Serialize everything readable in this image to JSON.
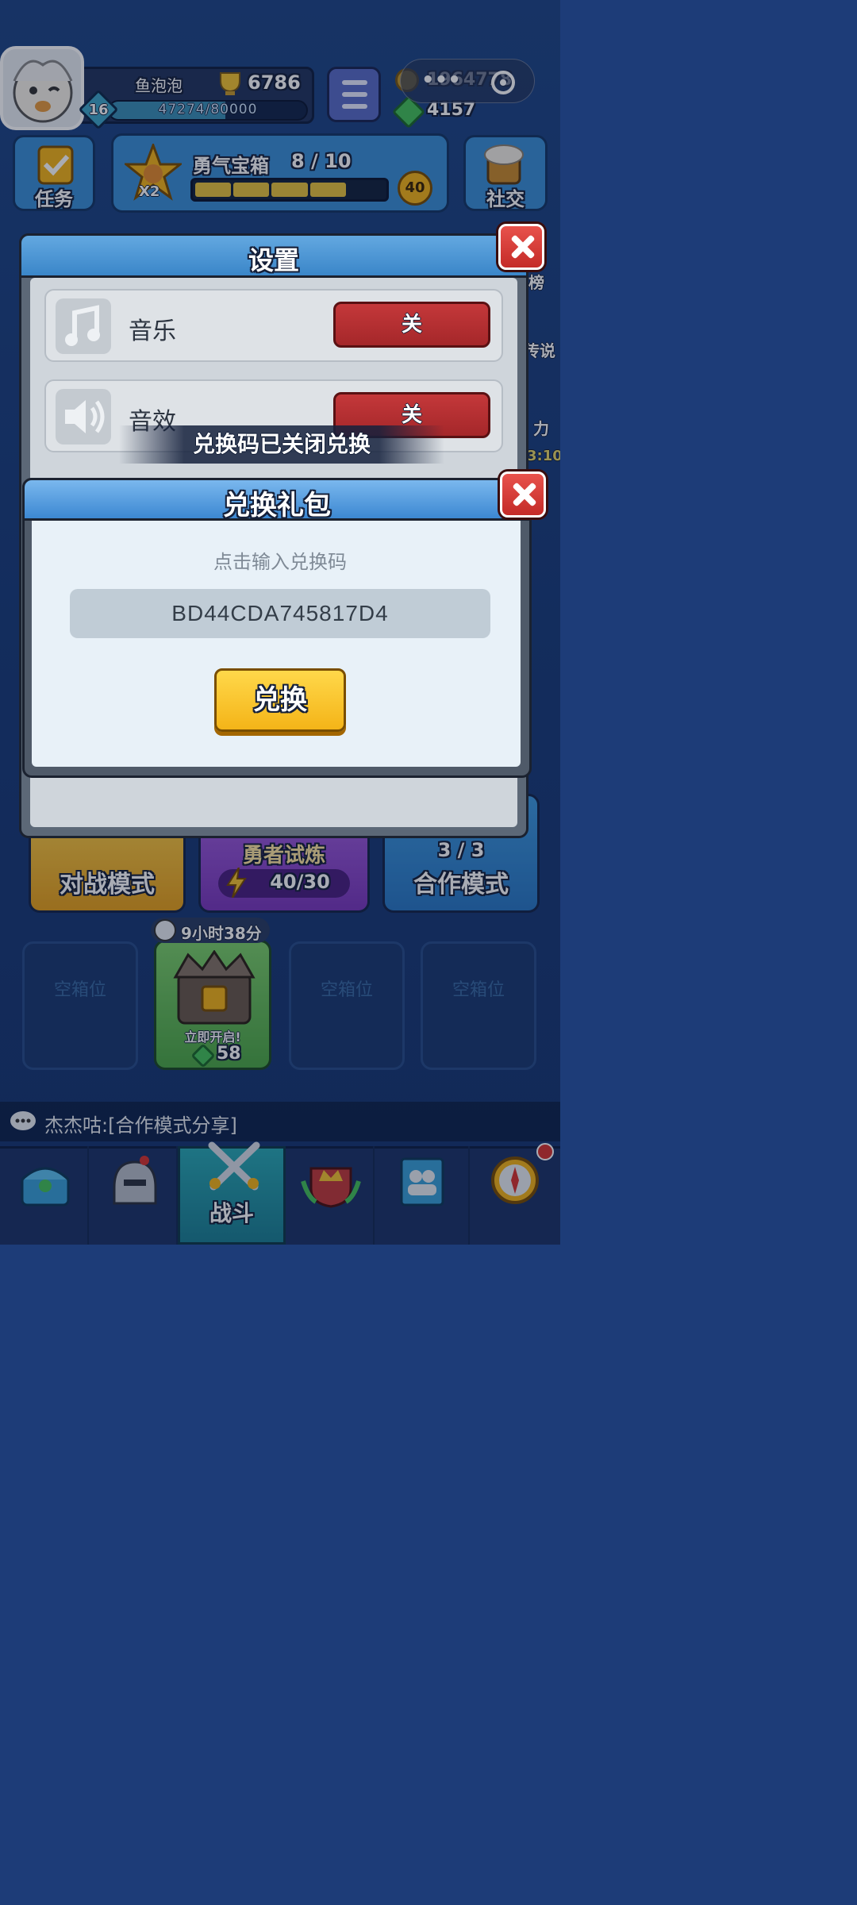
{
  "player": {
    "name": "鱼泡泡",
    "trophies": "6786",
    "level": "16",
    "xp": "47274/80000",
    "xp_fraction": 0.59
  },
  "currency": {
    "gold": "1964778",
    "gems": "4157"
  },
  "top": {
    "tasks_label": "任务",
    "chest_title": "勇气宝箱",
    "chest_progress": "8 / 10",
    "chest_multiplier": "X2",
    "chest_cost": "40",
    "social_label": "社交"
  },
  "side": {
    "rank_label": "榜",
    "legend_label": "传说",
    "power_label": "力",
    "timer": "3:10"
  },
  "settings": {
    "title": "设置",
    "rows": [
      {
        "label": "音乐",
        "value": "关"
      },
      {
        "label": "音效",
        "value": "关"
      }
    ]
  },
  "toast": "兑换码已关闭兑换",
  "gift": {
    "title": "兑换礼包",
    "prompt": "点击输入兑换码",
    "code": "BD44CDA745817D4",
    "button": "兑换"
  },
  "modes": {
    "battle": "对战模式",
    "trial": "勇者试炼",
    "trial_energy": "40/30",
    "coop": "合作模式",
    "coop_count": "3 / 3"
  },
  "chests": {
    "empty_label": "空箱位",
    "timer": "9小时38分",
    "open_now": "立即开启!",
    "open_cost": "58"
  },
  "chat": "杰杰咕:[合作模式分享]",
  "nav": {
    "battle_label": "战斗"
  },
  "colors": {
    "accent_yellow": "#f4b418",
    "close_red": "#d8342f",
    "off_red": "#b02f31",
    "panel_blue": "#3b88d2"
  }
}
